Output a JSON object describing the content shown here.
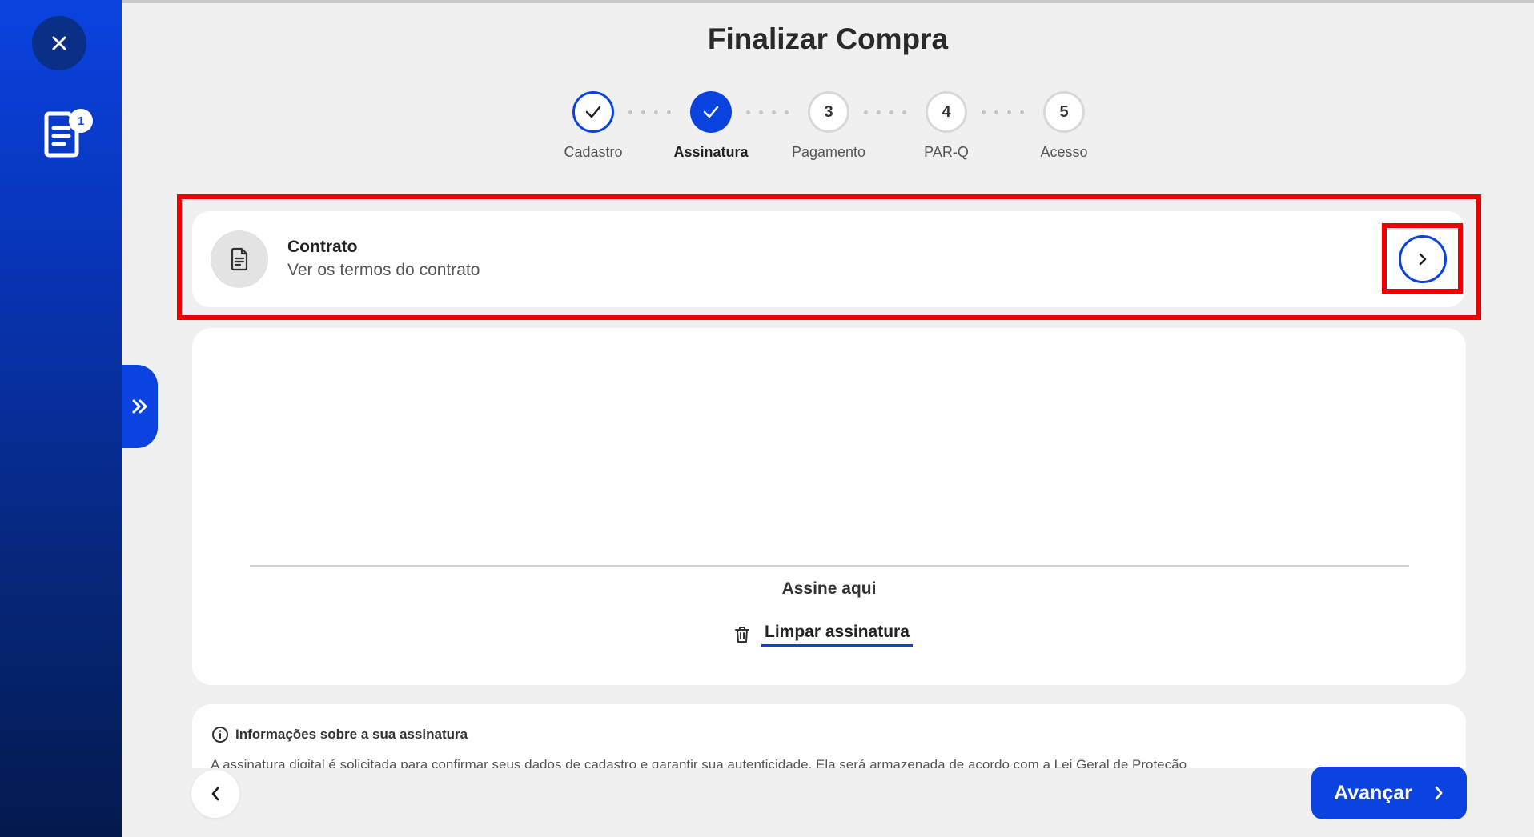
{
  "colors": {
    "accent": "#0a43e0",
    "highlight": "#ee0000",
    "background": "#f0f0f0"
  },
  "sidebar": {
    "close_icon": "close-icon",
    "cart_icon": "document-list-icon",
    "cart_badge": "1",
    "expand_icon": "double-chevron-right-icon"
  },
  "page": {
    "title": "Finalizar Compra"
  },
  "stepper": {
    "steps": [
      {
        "label": "Cadastro",
        "state": "done"
      },
      {
        "label": "Assinatura",
        "state": "current"
      },
      {
        "number": "3",
        "label": "Pagamento",
        "state": "pending"
      },
      {
        "number": "4",
        "label": "PAR-Q",
        "state": "pending"
      },
      {
        "number": "5",
        "label": "Acesso",
        "state": "pending"
      }
    ]
  },
  "contract": {
    "title": "Contrato",
    "subtitle": "Ver os termos do contrato",
    "icon": "document-icon",
    "open_icon": "chevron-right-icon"
  },
  "signature": {
    "label": "Assine aqui",
    "clear_label": "Limpar assinatura",
    "clear_icon": "trash-icon"
  },
  "info": {
    "title": "Informações sobre a sua assinatura",
    "text": "A assinatura digital é solicitada para confirmar seus dados de cadastro e garantir sua autenticidade. Ela será armazenada de acordo com a Lei Geral de Proteção"
  },
  "nav": {
    "back_icon": "chevron-left-icon",
    "next_label": "Avançar",
    "next_icon": "chevron-right-icon"
  }
}
